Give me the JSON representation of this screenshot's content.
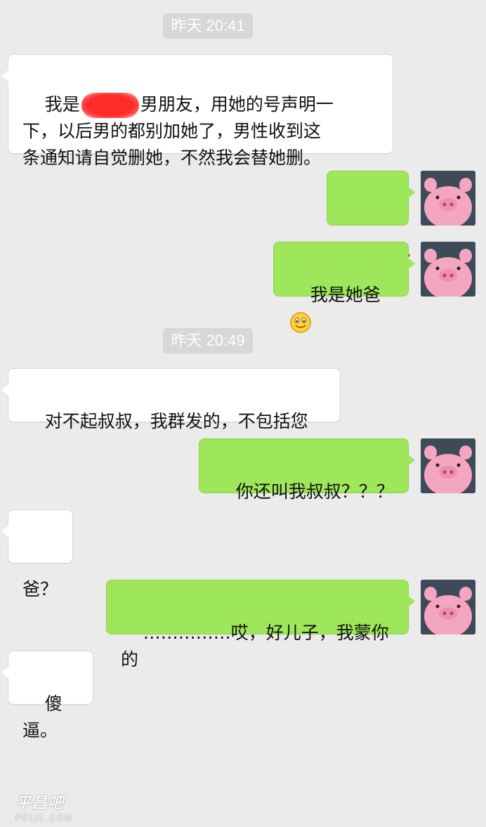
{
  "chat": {
    "timestamps": [
      "昨天 20:41",
      "昨天 20:49"
    ],
    "messages": [
      {
        "side": "in",
        "text_before": "我是",
        "redacted": true,
        "text_after": "男朋友，用她的号声明一\n下，以后男的都别加她了，男性收到这\n条通知请自觉删她，不然我会替她删。"
      },
      {
        "side": "out",
        "text": "…………"
      },
      {
        "side": "out",
        "text": "我是她爸",
        "emoji": "smile-emoji"
      },
      {
        "side": "in",
        "text": "对不起叔叔，我群发的，不包括您"
      },
      {
        "side": "out",
        "text": "你还叫我叔叔？？？"
      },
      {
        "side": "in",
        "text": "爸？"
      },
      {
        "side": "out",
        "text": "……………哎，好儿子，我蒙你的"
      },
      {
        "side": "in",
        "text": "傻逼。"
      }
    ],
    "avatar_icon": "pink-pig-avatar-icon"
  },
  "watermark": {
    "line1": "平昌吧",
    "line2": "PCLJL.COM"
  },
  "colors": {
    "background": "#ebebeb",
    "incoming_bubble": "#ffffff",
    "outgoing_bubble": "#9ee65a",
    "timestamp_bg": "#d7d7d7",
    "redaction": "#ff2a2a"
  }
}
